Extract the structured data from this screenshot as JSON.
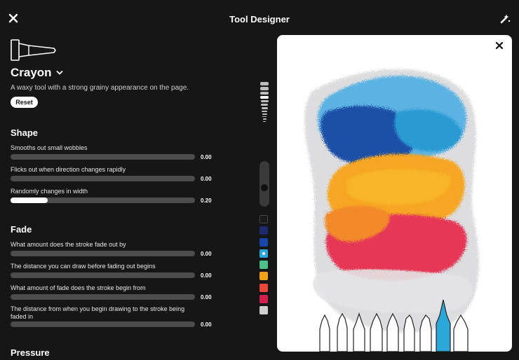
{
  "header": {
    "title": "Tool Designer"
  },
  "tool": {
    "name": "Crayon",
    "description": "A waxy tool with a strong grainy appearance on the page.",
    "reset_label": "Reset"
  },
  "shape": {
    "title": "Shape",
    "rows": [
      {
        "label": "Smooths out small wobbles",
        "value": "0.00",
        "level": 0
      },
      {
        "label": "Flicks out when direction changes rapidly",
        "value": "0.00",
        "level": 0
      },
      {
        "label": "Randomly changes in width",
        "value": "0.20",
        "level": 0.2
      }
    ]
  },
  "fade": {
    "title": "Fade",
    "rows": [
      {
        "label": "What amount does the stroke fade out by",
        "value": "0.00",
        "level": 0
      },
      {
        "label": "The distance you can draw before fading out begins",
        "value": "0.00",
        "level": 0
      },
      {
        "label": "What amount of fade does the stroke begin from",
        "value": "0.00",
        "level": 0
      },
      {
        "label": "The distance from when you begin drawing to the stroke being faded in",
        "value": "0.00",
        "level": 0
      }
    ]
  },
  "pressure": {
    "title": "Pressure"
  },
  "palette": {
    "swatches": [
      "#1b1b1b",
      "#1e2a6e",
      "#1746a8",
      "#2aa6d8",
      "#4cc08b",
      "#f5a21b",
      "#e8493c",
      "#d51f4f",
      "#cfcfcf"
    ],
    "selected_index": 3
  }
}
